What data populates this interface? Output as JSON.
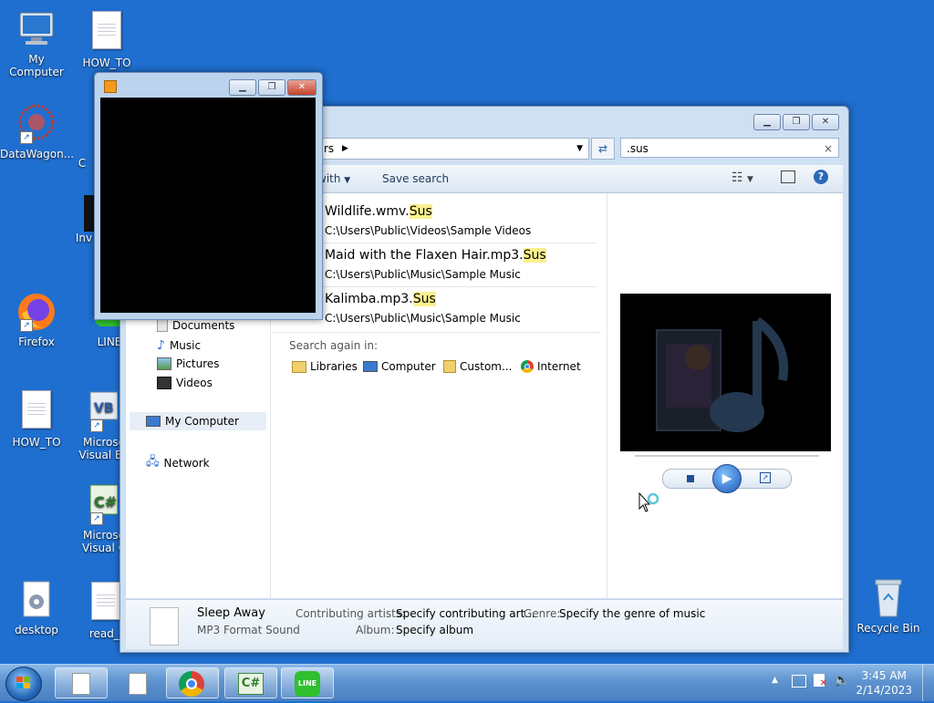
{
  "desktop_icons": [
    {
      "label": "My Computer"
    },
    {
      "label": "HOW_TO"
    },
    {
      "label": "DataWagon..."
    },
    {
      "label": "Firefox"
    },
    {
      "label": "LINE"
    },
    {
      "label": "HOW_TO"
    },
    {
      "label": "Microso Visual Ba"
    },
    {
      "label": "Microso Visual C"
    },
    {
      "label": "desktop"
    },
    {
      "label": "read_i"
    },
    {
      "label": "Recycle Bin"
    },
    {
      "label": "Inv"
    },
    {
      "label": "C"
    }
  ],
  "explorer": {
    "address_text": "rs",
    "search_value": ".sus",
    "toolbar": {
      "open_with": "with",
      "save_search": "Save search"
    },
    "nav": {
      "items": [
        "Documents",
        "Music",
        "Pictures",
        "Videos"
      ],
      "my_computer": "My Computer",
      "network": "Network"
    },
    "results": [
      {
        "name": "Wildlife.wmv.",
        "ext": "Sus",
        "path": "C:\\Users\\Public\\Videos\\Sample Videos"
      },
      {
        "name": "Maid with the Flaxen Hair.mp3.",
        "ext": "Sus",
        "path": "C:\\Users\\Public\\Music\\Sample Music"
      },
      {
        "name": "Kalimba.mp3.",
        "ext": "Sus",
        "path": "C:\\Users\\Public\\Music\\Sample Music"
      }
    ],
    "search_again": {
      "label": "Search again in:",
      "options": [
        "Libraries",
        "Computer",
        "Custom...",
        "Internet"
      ]
    },
    "details": {
      "file_name": "Sleep Away",
      "file_type": "MP3 Format Sound",
      "artists_label": "Contributing artists:",
      "artists_value": "Specify contributing art...",
      "genre_label": "Genre:",
      "genre_value": "Specify the genre of music",
      "album_label": "Album:",
      "album_value": "Specify album"
    }
  },
  "taskbar": {
    "time": "3:45 AM",
    "date": "2/14/2023",
    "apps": [
      "file-icon",
      "file-icon",
      "chrome-icon",
      "csharp-icon",
      "line-icon"
    ]
  },
  "colors": {
    "desktop": "#1f6fd0",
    "highlight": "#fbf18f"
  }
}
